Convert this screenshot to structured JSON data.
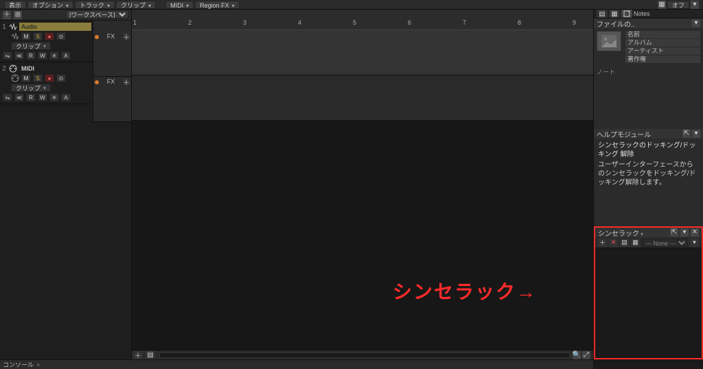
{
  "topbar": {
    "view": "表示",
    "options": "オプション",
    "track": "トラック",
    "clip": "クリップ",
    "midi": "MIDI",
    "regionfx": "Region FX",
    "off_label": "オフ"
  },
  "trackpane": {
    "workspace_label": "[ワークスペース]",
    "tracks": [
      {
        "num": "1",
        "name": "Audio",
        "type": "audio",
        "mute": "M",
        "solo": "S",
        "rec": "●",
        "clip_label": "クリップ",
        "btns_row4": [
          "⇋",
          "≪",
          "R",
          "W",
          "✳",
          "A"
        ],
        "fx_label": "FX"
      },
      {
        "num": "2",
        "name": "MIDI",
        "type": "midi",
        "mute": "M",
        "solo": "S",
        "rec": "●",
        "clip_label": "クリップ",
        "btns_row4": [
          "⇋",
          "≪",
          "R",
          "W",
          "✳",
          "A"
        ],
        "fx_label": "FX"
      }
    ]
  },
  "ruler": {
    "ticks": [
      "1",
      "2",
      "3",
      "4",
      "5",
      "6",
      "7",
      "8",
      "9"
    ]
  },
  "rightdock": {
    "notes_tab": "Notes",
    "fileinfo_label": "ファイルの..",
    "meta": {
      "name": "名前",
      "album": "アルバム",
      "artist": "アーティスト",
      "copyright": "著作権"
    },
    "notes_label": "ノート",
    "help": {
      "panel": "ヘルプモジュール",
      "title": "シンセラックのドッキング/ドッキング 解除",
      "body": "ユーザーインターフェースからのシンセラックをドッキング/ドッキング解除します。"
    },
    "synth": {
      "panel": "シンセラック",
      "none_option": "--- None ---"
    }
  },
  "console": {
    "tab": "コンソール"
  },
  "annotation": "シンセラック→"
}
